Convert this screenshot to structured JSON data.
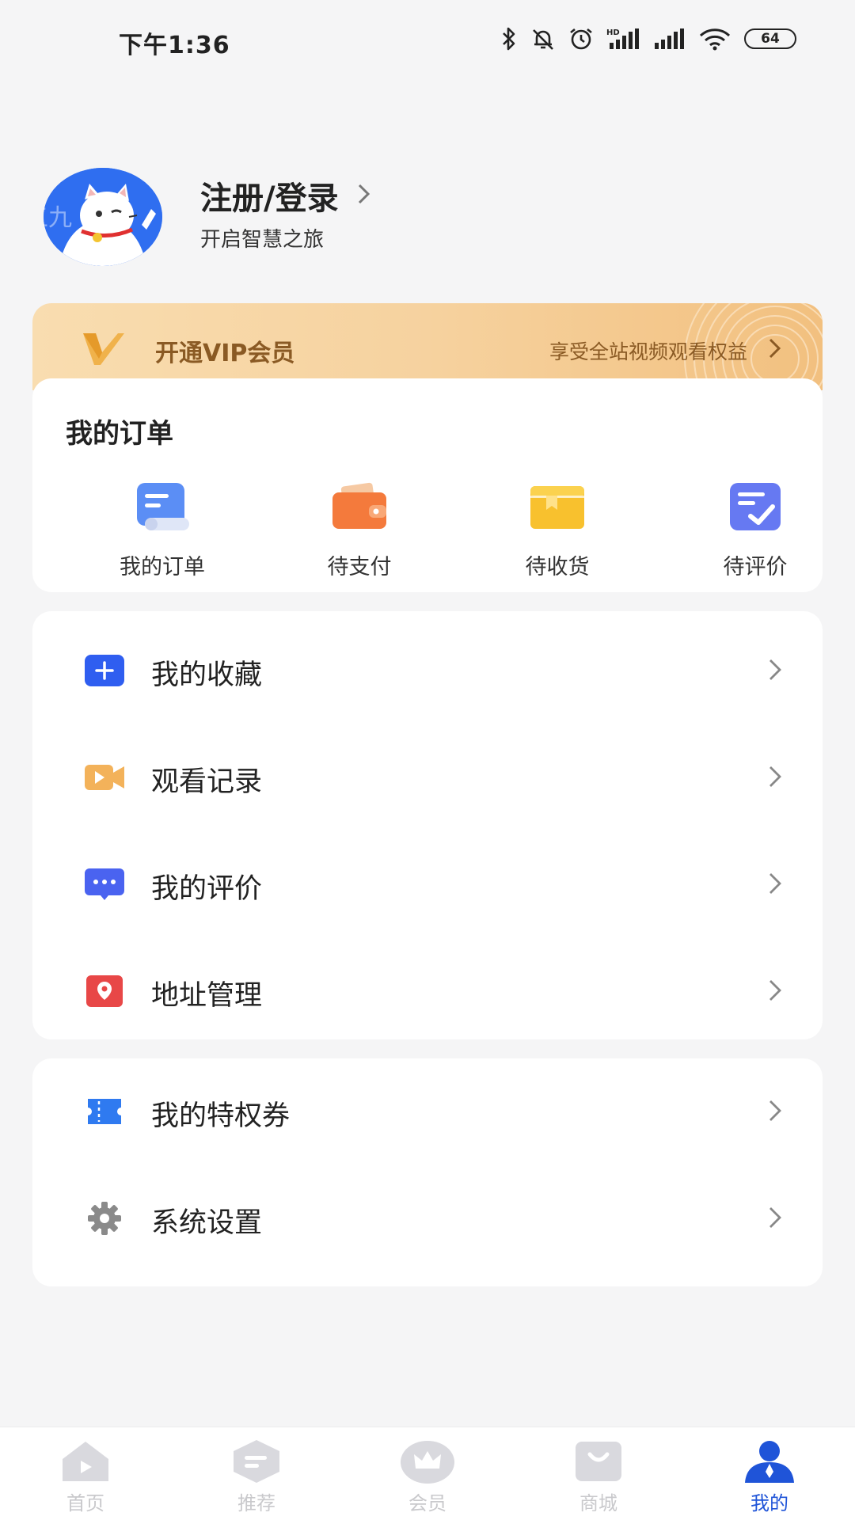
{
  "status_bar": {
    "time": "下午1:36",
    "battery": "64"
  },
  "profile": {
    "name": "注册/登录",
    "subtitle": "开启智慧之旅",
    "avatar_watermark": "五九"
  },
  "vip": {
    "title": "开通VIP会员",
    "description": "享受全站视频观看权益",
    "accent_color": "#8a5a24"
  },
  "orders": {
    "title": "我的订单",
    "items": [
      {
        "label": "我的订单",
        "icon": "order-list-icon"
      },
      {
        "label": "待支付",
        "icon": "wallet-icon"
      },
      {
        "label": "待收货",
        "icon": "package-icon"
      },
      {
        "label": "待评价",
        "icon": "review-icon"
      }
    ]
  },
  "menu_group_1": [
    {
      "label": "我的收藏",
      "icon": "favorite-plus-icon",
      "color": "#2f5ef0"
    },
    {
      "label": "观看记录",
      "icon": "video-camera-icon",
      "color": "#f3b25a"
    },
    {
      "label": "我的评价",
      "icon": "comment-icon",
      "color": "#4a63f0"
    },
    {
      "label": "地址管理",
      "icon": "location-icon",
      "color": "#e84747"
    }
  ],
  "menu_group_2": [
    {
      "label": "我的特权券",
      "icon": "ticket-icon",
      "color": "#2f7af0"
    },
    {
      "label": "系统设置",
      "icon": "gear-icon",
      "color": "#8a8a8a"
    }
  ],
  "bottom_nav": [
    {
      "label": "首页",
      "icon": "home-icon",
      "active": false
    },
    {
      "label": "推荐",
      "icon": "recommend-icon",
      "active": false
    },
    {
      "label": "会员",
      "icon": "crown-icon",
      "active": false
    },
    {
      "label": "商城",
      "icon": "shop-bag-icon",
      "active": false
    },
    {
      "label": "我的",
      "icon": "profile-icon",
      "active": true
    }
  ],
  "colors": {
    "primary": "#1f54d8",
    "nav_inactive": "#c9c9cc",
    "background": "#f5f5f6"
  }
}
